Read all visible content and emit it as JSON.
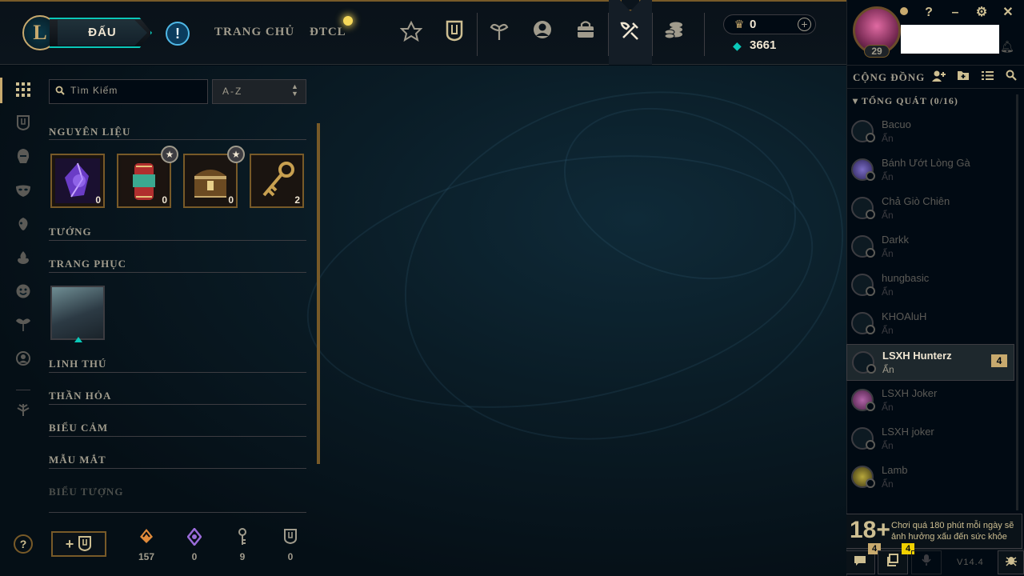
{
  "header": {
    "logo": "L",
    "play_button": "ĐẤU",
    "alert_icon": "!",
    "nav": [
      "TRANG CHỦ",
      "ĐTCL"
    ],
    "icons": [
      "honor-icon",
      "collection-icon",
      "tft-icon",
      "profile-icon",
      "store-icon",
      "loot-icon",
      "currency-store-icon"
    ],
    "active_icon": "loot-icon"
  },
  "wallet": {
    "rp": "0",
    "blue_essence": "3661",
    "add": "+"
  },
  "profile": {
    "level": "29"
  },
  "window": {
    "help": "?",
    "minimize": "–",
    "settings": "⚙",
    "close": "✕"
  },
  "social": {
    "title": "CỘNG ĐỒNG",
    "group": "TỔNG QUÁT (0/16)",
    "friends": [
      {
        "name": "Bacuo",
        "status": "Ẩn"
      },
      {
        "name": "Bánh Ướt Lòng Gà",
        "status": "Ẩn"
      },
      {
        "name": "Chả Giò Chiên",
        "status": "Ẩn"
      },
      {
        "name": "Darkk",
        "status": "Ẩn"
      },
      {
        "name": "hungbasic",
        "status": "Ẩn"
      },
      {
        "name": "KHOAluH",
        "status": "Ẩn"
      },
      {
        "name": "LSXH Hunterz",
        "status": "Ẩn",
        "badge": "4"
      },
      {
        "name": "LSXH Joker",
        "status": "Ẩn"
      },
      {
        "name": "LSXH joker",
        "status": "Ẩn"
      },
      {
        "name": "Lamb",
        "status": "Ẩn"
      }
    ],
    "health_age": "18+",
    "health_text": "Chơi quá 180 phút mỗi ngày sẽ ảnh hưởng xấu đến sức khỏe",
    "chat_count": "4",
    "missions_count": "4",
    "version": "V14.4"
  },
  "loot": {
    "search_placeholder": "Tìm Kiếm",
    "sort": "A-Z",
    "categories": {
      "materials": "NGUYÊN LIỆU",
      "champions": "TƯỚNG",
      "skins": "TRANG PHỤC",
      "pets": "LINH THÚ",
      "wards": "THẦN HỎA",
      "emotes": "BIỂU CẢM",
      "eyes": "MẪU MẮT",
      "icons": "BIỂU TƯỢNG"
    },
    "materials": [
      {
        "name": "essence-crystal",
        "count": "0"
      },
      {
        "name": "capsule",
        "count": "0"
      },
      {
        "name": "chest",
        "count": "0"
      },
      {
        "name": "key",
        "count": "2"
      }
    ],
    "resources": [
      {
        "icon": "orange-essence-icon",
        "value": "157",
        "color": "#e08a3a"
      },
      {
        "icon": "mythic-essence-icon",
        "value": "0",
        "color": "#9a6bd8"
      },
      {
        "icon": "key-fragment-icon",
        "value": "9",
        "color": "#a09b8c"
      },
      {
        "icon": "collection-token-icon",
        "value": "0",
        "color": "#a09b8c"
      }
    ]
  },
  "colors": {
    "gold": "#c8aa6e",
    "teal": "#0ac8b9",
    "dark": "#010a13"
  }
}
